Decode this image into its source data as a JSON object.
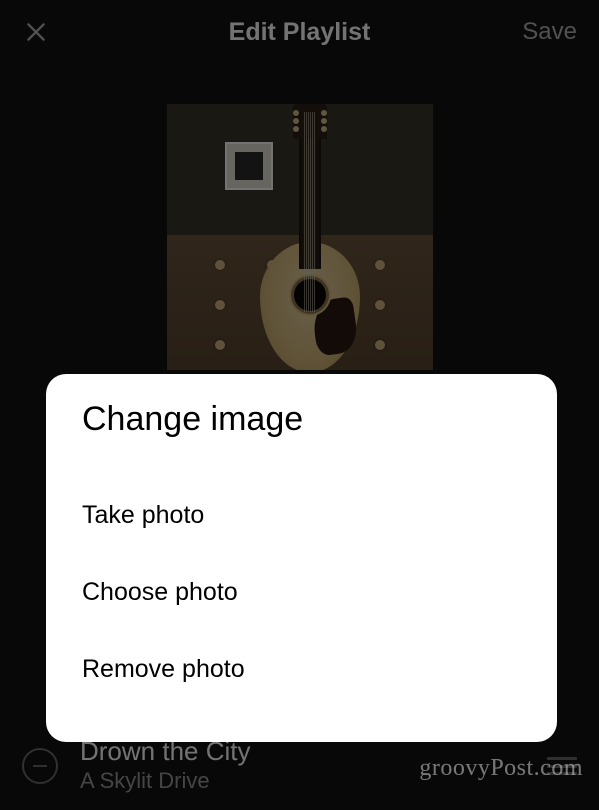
{
  "header": {
    "title": "Edit Playlist",
    "save_label": "Save"
  },
  "track": {
    "title": "Drown the City",
    "artist": "A Skylit Drive"
  },
  "sheet": {
    "title": "Change image",
    "take_photo": "Take photo",
    "choose_photo": "Choose photo",
    "remove_photo": "Remove photo"
  },
  "watermark": "groovyPost.com"
}
